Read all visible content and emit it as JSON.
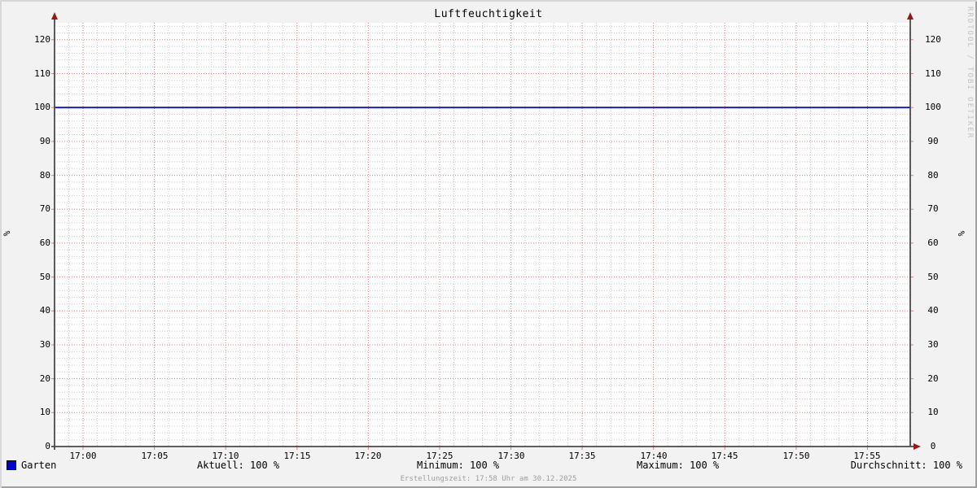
{
  "title": "Luftfeuchtigkeit",
  "watermark": "RRDTOOL / TOBI OETIKER",
  "footer": "Erstellungszeit: 17:58 Uhr am 30.12.2025",
  "axis": {
    "vertical_label_left": "%",
    "vertical_label_right": "%"
  },
  "legend": {
    "series_swatch_color": "#0000d2",
    "series_label": "Garten",
    "stats": [
      {
        "label": "Aktuell: 100 %"
      },
      {
        "label": "Minimum: 100 %"
      },
      {
        "label": "Maximum: 100 %"
      },
      {
        "label": "Durchschnitt: 100 %"
      }
    ]
  },
  "colors": {
    "background": "#f2f2f2",
    "canvas": "#ffffff",
    "axis": "#4a4a4a",
    "arrow": "#961919",
    "major_grid": "#e17d7d",
    "minor_grid": "#c9c9c9",
    "line": "#0f0fcd",
    "footer_text": "#9e9e9e",
    "watermark_text": "#c2c2c2"
  },
  "chart_data": {
    "type": "line",
    "title": "Luftfeuchtigkeit",
    "ylabel": "%",
    "ylim": [
      0,
      125
    ],
    "x_start": "16:58",
    "x_end": "17:58",
    "x_ticks": [
      "17:00",
      "17:05",
      "17:10",
      "17:15",
      "17:20",
      "17:25",
      "17:30",
      "17:35",
      "17:40",
      "17:45",
      "17:50",
      "17:55"
    ],
    "x_minor_step_minutes": 1,
    "y_ticks": [
      0,
      10,
      20,
      30,
      40,
      50,
      60,
      70,
      80,
      90,
      100,
      110,
      120
    ],
    "y_minor_step": 2,
    "grid": true,
    "legend_position": "bottom",
    "series": [
      {
        "name": "Garten",
        "color": "#0f0fcd",
        "x": [
          "16:58",
          "17:58"
        ],
        "values": [
          100,
          100
        ]
      }
    ]
  }
}
